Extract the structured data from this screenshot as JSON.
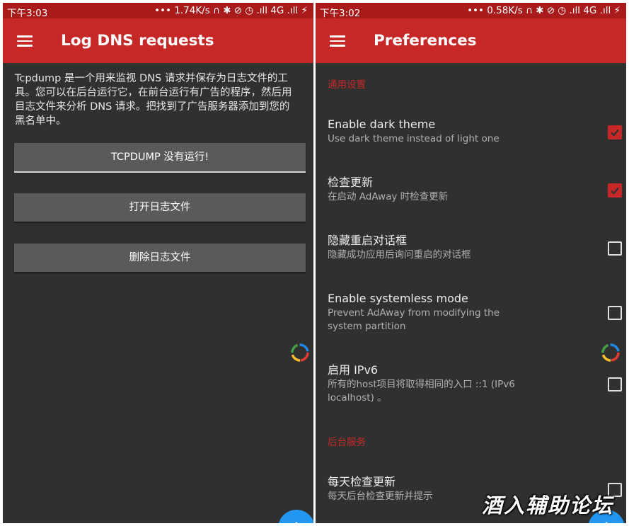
{
  "left": {
    "status": {
      "time": "下午3:03",
      "right": "••• 1.74K/s ∩ ✱ ⊘ ◷ .ıll 4G .ıll ⚡"
    },
    "toolbar": {
      "title": "Log DNS requests"
    },
    "description": "Tcpdump 是一个用来监视 DNS 请求并保存为日志文件的工具。您可以在后台运行它，在前台运行有广告的程序，然后用目志文件来分析 DNS 请求。把找到了广告服务器添加到您的黑名单中。",
    "buttons": {
      "tcpdump": "TCPDUMP 没有运行!",
      "open_log": "打开日志文件",
      "delete_log": "删除日志文件"
    }
  },
  "right": {
    "status": {
      "time": "下午3:02",
      "right": "••• 0.58K/s ∩ ✱ ⊘ ◷ .ıll 4G .ıll ⚡"
    },
    "toolbar": {
      "title": "Preferences"
    },
    "sections": {
      "general": "通用设置",
      "background": "后台服务"
    },
    "prefs": [
      {
        "title": "Enable dark theme",
        "summary": "Use dark theme instead of light one",
        "checked": true
      },
      {
        "title": "检查更新",
        "summary": "在启动 AdAway 时检查更新",
        "checked": true
      },
      {
        "title": "隐藏重启对话框",
        "summary": "隐藏成功应用后询问重启的对话框",
        "checked": false
      },
      {
        "title": "Enable systemless mode",
        "summary": "Prevent AdAway from modifying the system partition",
        "checked": false
      },
      {
        "title": "启用 IPv6",
        "summary": "所有的host项目将取得相同的入口 ::1 (IPv6 localhost) 。",
        "checked": false
      },
      {
        "title": "每天检查更新",
        "summary": "每天后台检查更新并提示",
        "checked": false
      }
    ]
  },
  "watermark": "酒入辅助论坛",
  "colors": {
    "primary": "#c62828",
    "status_bar": "#a91b1b",
    "background": "#303030",
    "fab": "#2196f3"
  },
  "icons": {
    "menu": "hamburger-icon",
    "spinner": "progress-spinner-icon",
    "fab": "plus-icon"
  }
}
